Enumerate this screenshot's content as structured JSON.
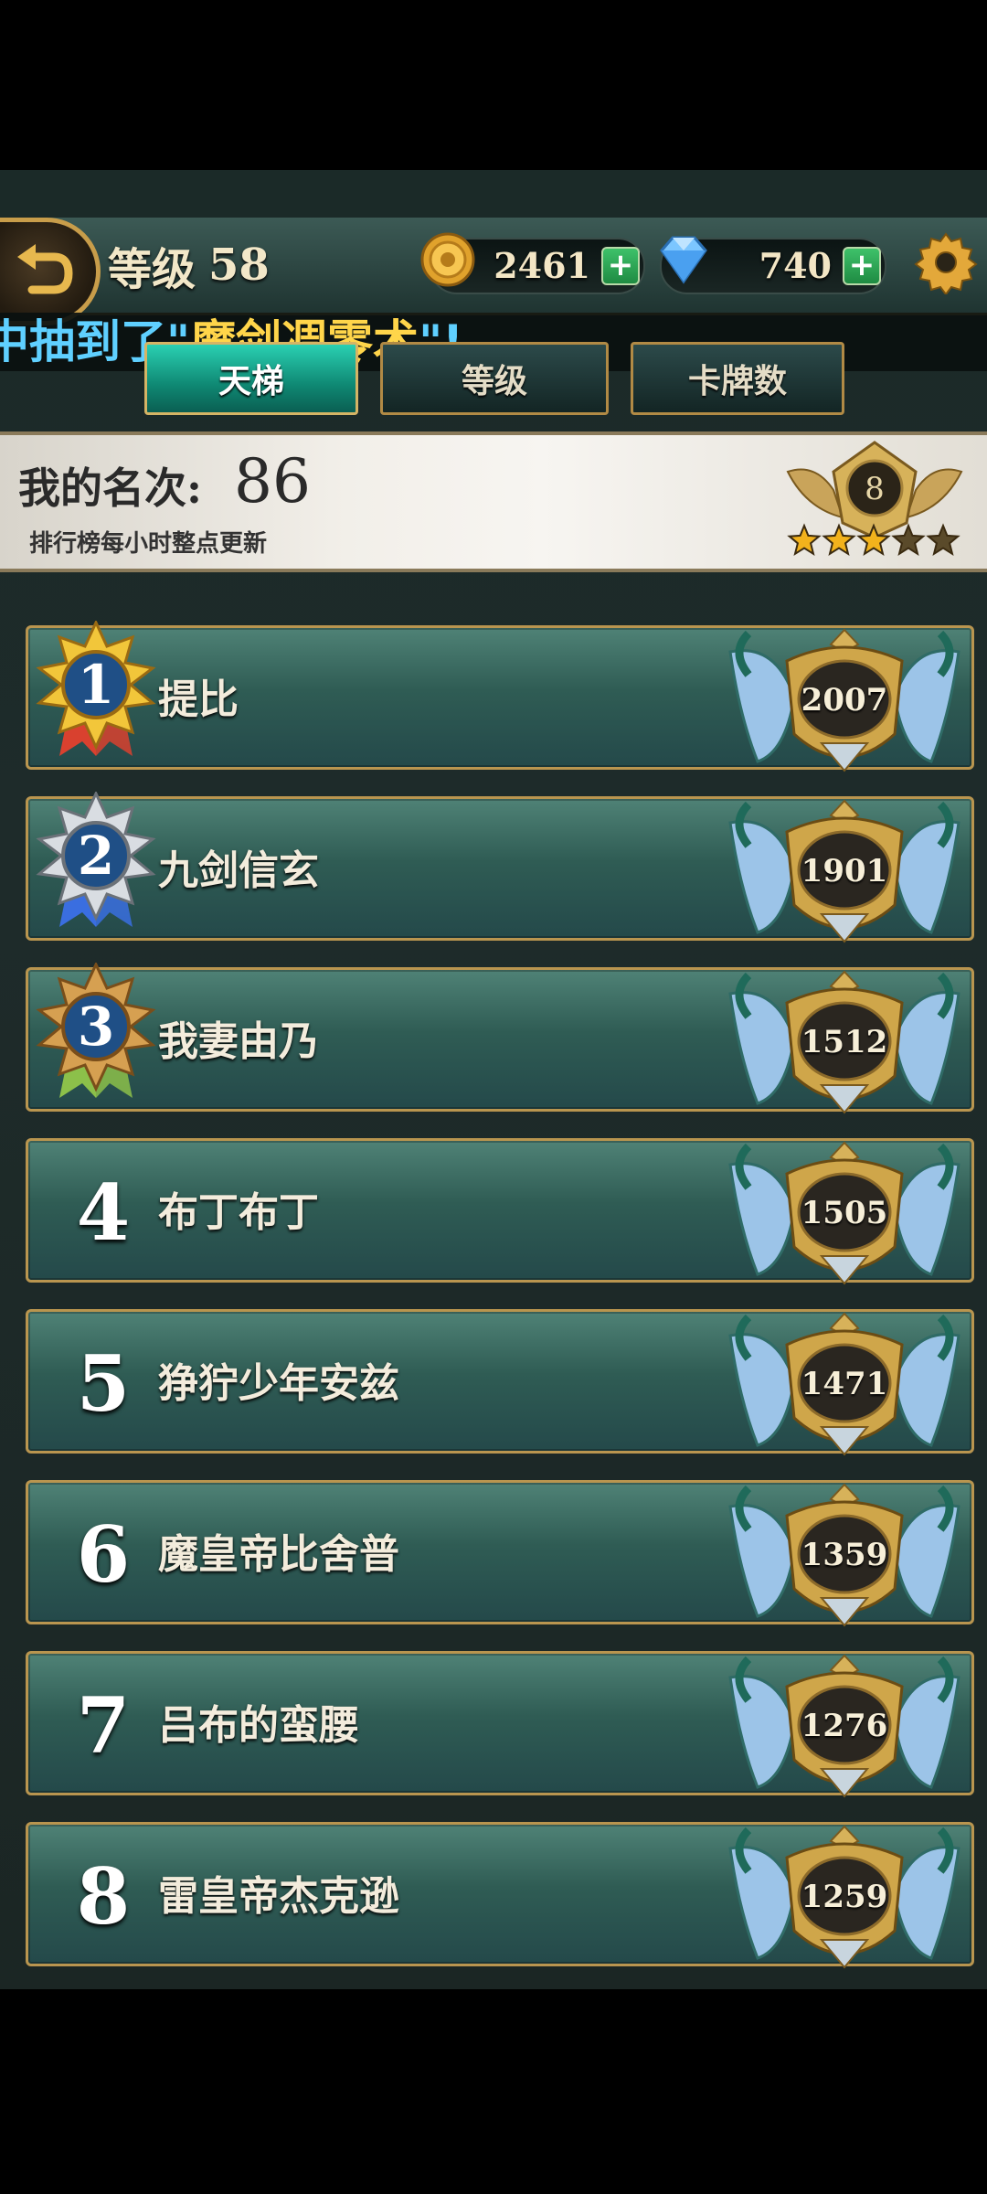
{
  "header": {
    "level_label": "等级",
    "level_value": "58",
    "gold": "2461",
    "gems": "740",
    "plus_symbol": "+"
  },
  "marquee": {
    "prefix": "中抽到了\"",
    "item": "魔剑凋零术",
    "suffix": "\"!"
  },
  "tabs": [
    {
      "label": "天梯",
      "active": true
    },
    {
      "label": "等级",
      "active": false
    },
    {
      "label": "卡牌数",
      "active": false
    }
  ],
  "my_rank": {
    "label": "我的名次:",
    "value": "86",
    "note": "排行榜每小时整点更新",
    "badge_level": "8",
    "stars": 3,
    "stars_total": 5
  },
  "leaderboard": [
    {
      "rank": "1",
      "name": "提比",
      "score": "2007"
    },
    {
      "rank": "2",
      "name": "九剑信玄",
      "score": "1901"
    },
    {
      "rank": "3",
      "name": "我妻由乃",
      "score": "1512"
    },
    {
      "rank": "4",
      "name": "布丁布丁",
      "score": "1505"
    },
    {
      "rank": "5",
      "name": "狰狞少年安兹",
      "score": "1471"
    },
    {
      "rank": "6",
      "name": "魔皇帝比舍普",
      "score": "1359"
    },
    {
      "rank": "7",
      "name": "吕布的蛮腰",
      "score": "1276"
    },
    {
      "rank": "8",
      "name": "雷皇帝杰克逊",
      "score": "1259"
    }
  ],
  "colors": {
    "accent_gold": "#b9954f",
    "tab_active": "#1fb39a",
    "marquee_text": "#5fd0ff",
    "marquee_item": "#ffd54a",
    "star_filled": "#f2b21c",
    "star_empty": "#5a4a2a"
  },
  "icons": {
    "back": "back-arrow-icon",
    "gold": "gold-coin-icon",
    "gem": "diamond-icon",
    "settings": "gear-icon"
  }
}
